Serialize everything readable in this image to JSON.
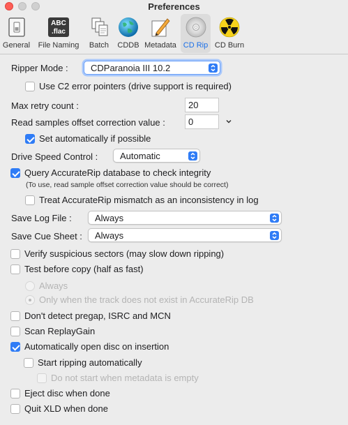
{
  "window": {
    "title": "Preferences"
  },
  "toolbar": {
    "items": [
      {
        "label": "General",
        "icon": "switch-icon"
      },
      {
        "label": "File Naming",
        "icon": "abc-flac-icon",
        "icon_text_1": "ABC",
        "icon_text_2": ".flac"
      },
      {
        "label": "Batch",
        "icon": "documents-icon"
      },
      {
        "label": "CDDB",
        "icon": "globe-icon"
      },
      {
        "label": "Metadata",
        "icon": "pencil-icon"
      },
      {
        "label": "CD Rip",
        "icon": "disc-icon",
        "selected": true
      },
      {
        "label": "CD Burn",
        "icon": "radiation-icon"
      }
    ],
    "selected_color": "#1a6fe8"
  },
  "ripper_mode": {
    "label": "Ripper Mode :",
    "value": "CDParanoia III 10.2"
  },
  "use_c2": {
    "label": "Use C2 error pointers (drive support is required)",
    "checked": false
  },
  "max_retry": {
    "label": "Max retry count :",
    "value": "20"
  },
  "offset": {
    "label": "Read samples offset correction value :",
    "value": "0"
  },
  "set_auto": {
    "label": "Set automatically if possible",
    "checked": true
  },
  "drive_speed": {
    "label": "Drive Speed Control :",
    "value": "Automatic"
  },
  "accuraterip": {
    "label": "Query AccurateRip database to check integrity",
    "note": "(To use, read sample offset correction value should be correct)",
    "checked": true
  },
  "treat_mismatch": {
    "label": "Treat AccurateRip mismatch as an inconsistency in log",
    "checked": false
  },
  "save_log": {
    "label": "Save Log File :",
    "value": "Always"
  },
  "save_cue": {
    "label": "Save Cue Sheet :",
    "value": "Always"
  },
  "verify": {
    "label": "Verify suspicious sectors (may slow down ripping)",
    "checked": false
  },
  "test_before": {
    "label": "Test before copy (half as fast)",
    "checked": false
  },
  "test_radio": {
    "always": "Always",
    "only_when": "Only when the track does not exist in AccurateRip DB",
    "selected": "only_when"
  },
  "no_pregap": {
    "label": "Don't detect pregap, ISRC and MCN",
    "checked": false
  },
  "replaygain": {
    "label": "Scan ReplayGain",
    "checked": false
  },
  "auto_open": {
    "label": "Automatically open disc on insertion",
    "checked": true
  },
  "start_auto": {
    "label": "Start ripping automatically",
    "checked": false
  },
  "no_start_meta": {
    "label": "Do not start when metadata is empty",
    "checked": false
  },
  "eject": {
    "label": "Eject disc when done",
    "checked": false
  },
  "quit": {
    "label": "Quit XLD when done",
    "checked": false
  },
  "colors": {
    "accent": "#2f7cf6",
    "close": "#fe5f57"
  }
}
